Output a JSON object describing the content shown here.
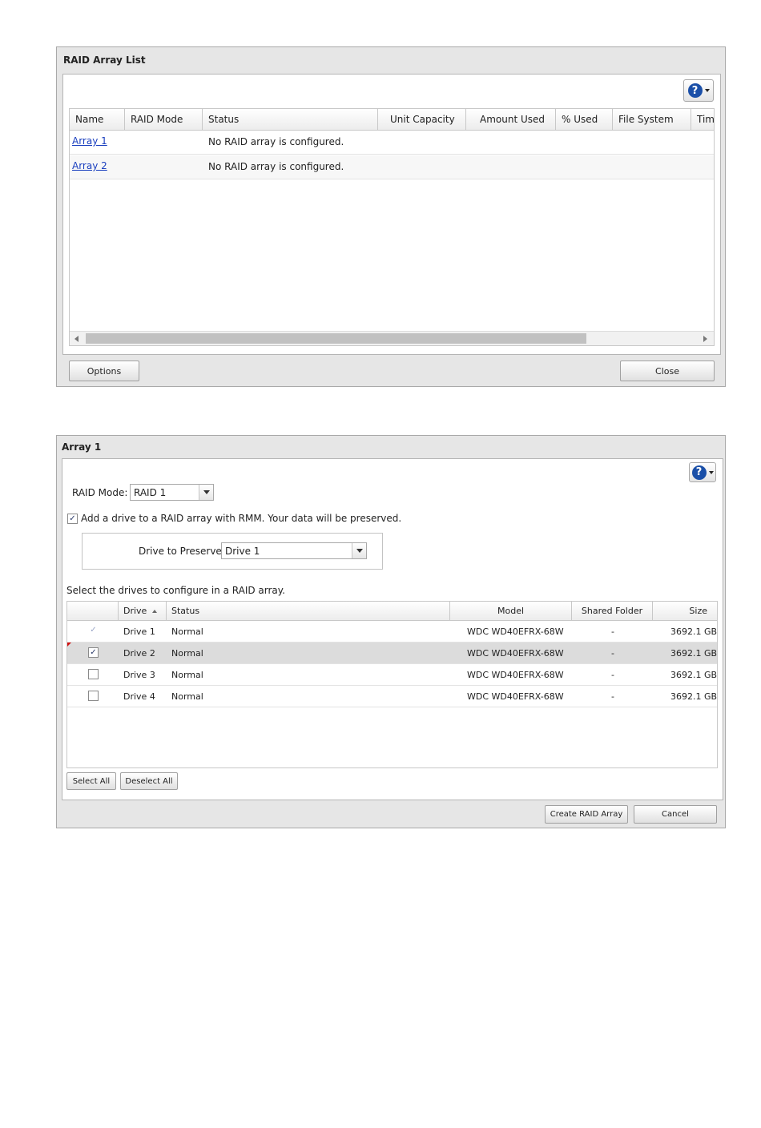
{
  "raid_list": {
    "title": "RAID Array List",
    "help_icon": "question-icon",
    "columns": [
      "Name",
      "RAID Mode",
      "Status",
      "Unit Capacity",
      "Amount Used",
      "% Used",
      "File System",
      "Tim"
    ],
    "rows": [
      {
        "name": "Array 1",
        "raid_mode": "",
        "status": "No RAID array is configured."
      },
      {
        "name": "Array 2",
        "raid_mode": "",
        "status": "No RAID array is configured."
      }
    ],
    "options_label": "Options",
    "close_label": "Close"
  },
  "array_dialog": {
    "title": "Array 1",
    "help_icon": "question-icon",
    "raid_mode_label": "RAID Mode:",
    "raid_mode_value": "RAID 1",
    "rmm_checked": true,
    "rmm_label": "Add a drive to a RAID array with RMM. Your data will be preserved.",
    "preserve_label": "Drive to Preserve:",
    "preserve_value": "Drive 1",
    "select_prompt": "Select the drives to configure in a RAID array.",
    "columns": [
      "Drive",
      "Status",
      "Model",
      "Shared Folder",
      "Size"
    ],
    "drives": [
      {
        "checked": true,
        "disabled": true,
        "drive": "Drive 1",
        "status": "Normal",
        "model": "WDC WD40EFRX-68W",
        "shared": "-",
        "size": "3692.1 GB"
      },
      {
        "checked": true,
        "disabled": false,
        "drive": "Drive 2",
        "status": "Normal",
        "model": "WDC WD40EFRX-68W",
        "shared": "-",
        "size": "3692.1 GB"
      },
      {
        "checked": false,
        "disabled": false,
        "drive": "Drive 3",
        "status": "Normal",
        "model": "WDC WD40EFRX-68W",
        "shared": "-",
        "size": "3692.1 GB"
      },
      {
        "checked": false,
        "disabled": false,
        "drive": "Drive 4",
        "status": "Normal",
        "model": "WDC WD40EFRX-68W",
        "shared": "-",
        "size": "3692.1 GB"
      }
    ],
    "select_all_label": "Select All",
    "deselect_all_label": "Deselect All",
    "create_label": "Create RAID Array",
    "cancel_label": "Cancel"
  }
}
